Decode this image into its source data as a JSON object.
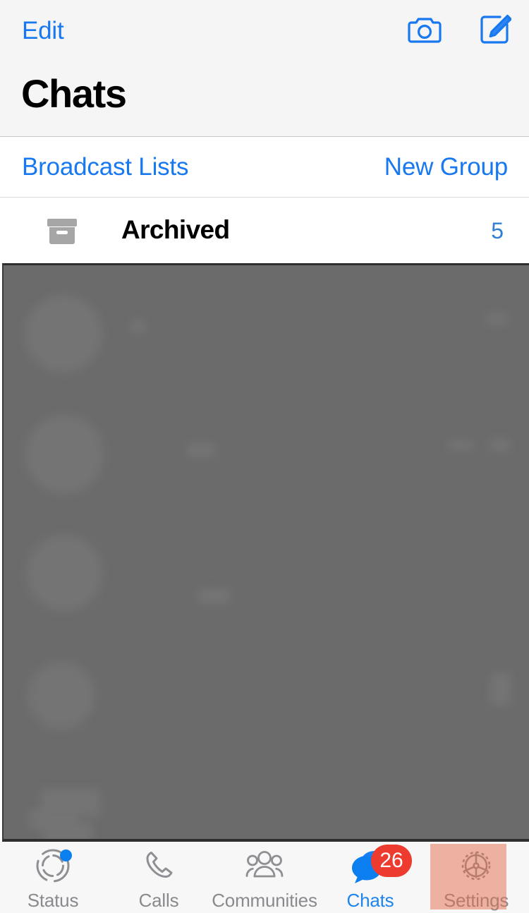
{
  "header": {
    "edit_label": "Edit",
    "title": "Chats",
    "camera_icon": "camera-icon",
    "compose_icon": "compose-icon"
  },
  "action_row": {
    "broadcast_lists_label": "Broadcast Lists",
    "new_group_label": "New Group"
  },
  "archived": {
    "icon": "archive-box-icon",
    "label": "Archived",
    "count": "5"
  },
  "chat_list": {
    "state": "redacted"
  },
  "tab_bar": {
    "items": [
      {
        "label": "Status",
        "icon": "status-ring-icon",
        "active": false,
        "badge": "",
        "dot": true
      },
      {
        "label": "Calls",
        "icon": "phone-icon",
        "active": false,
        "badge": "",
        "dot": false
      },
      {
        "label": "Communities",
        "icon": "communities-icon",
        "active": false,
        "badge": "",
        "dot": false
      },
      {
        "label": "Chats",
        "icon": "chat-bubbles-icon",
        "active": true,
        "badge": "26",
        "dot": false
      },
      {
        "label": "Settings",
        "icon": "gear-icon",
        "active": false,
        "badge": "",
        "dot": false
      }
    ]
  },
  "colors": {
    "accent_blue": "#1878f0",
    "badge_red": "#ee3b2f",
    "inactive_gray": "#8a8a8e",
    "header_bg": "#f5f5f5",
    "tabbar_bg": "#f7f7f7",
    "highlight_salmon": "#e26c4c",
    "redaction_gray": "#6b6b6b"
  }
}
